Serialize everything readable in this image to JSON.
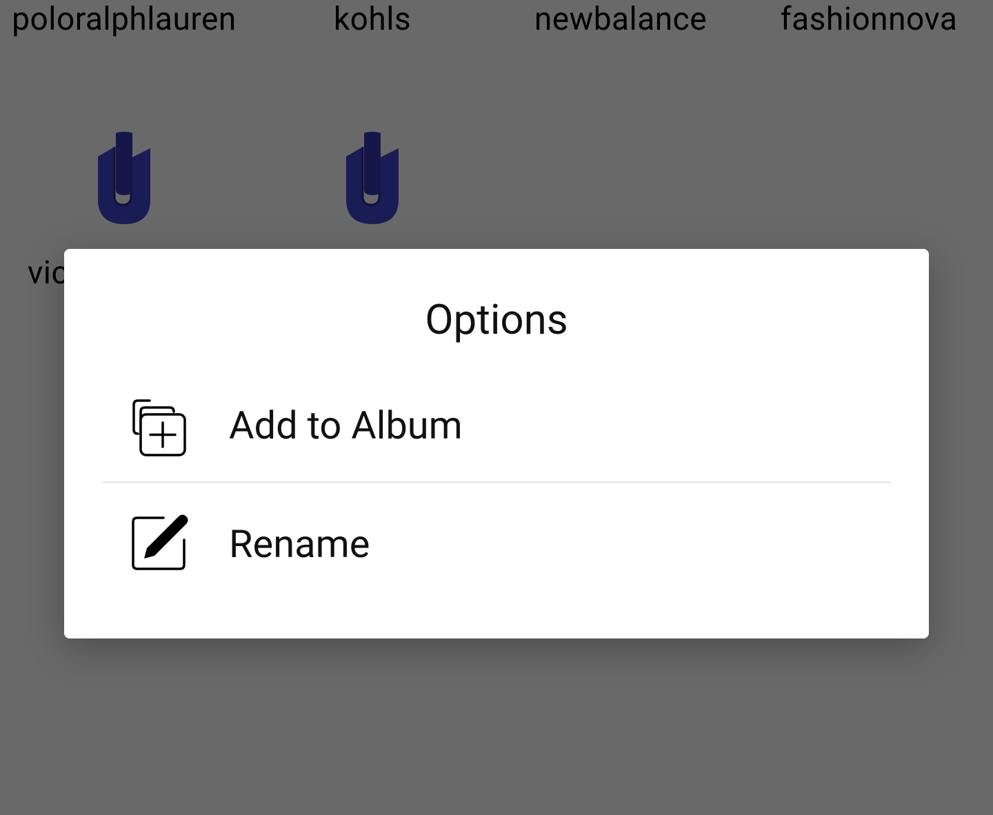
{
  "background": {
    "labels": [
      "poloralphlauren",
      "kohls",
      "newbalance",
      "fashionnova"
    ],
    "partial_label": "vic",
    "logo_name": "paperclip-logo-icon"
  },
  "dialog": {
    "title": "Options",
    "options": [
      {
        "label": "Add to Album",
        "icon": "add-to-album-icon"
      },
      {
        "label": "Rename",
        "icon": "edit-icon"
      }
    ]
  },
  "colors": {
    "overlay_background": "#696969",
    "dialog_background": "#ffffff",
    "logo": "#1a1c55",
    "divider": "#ececec"
  }
}
